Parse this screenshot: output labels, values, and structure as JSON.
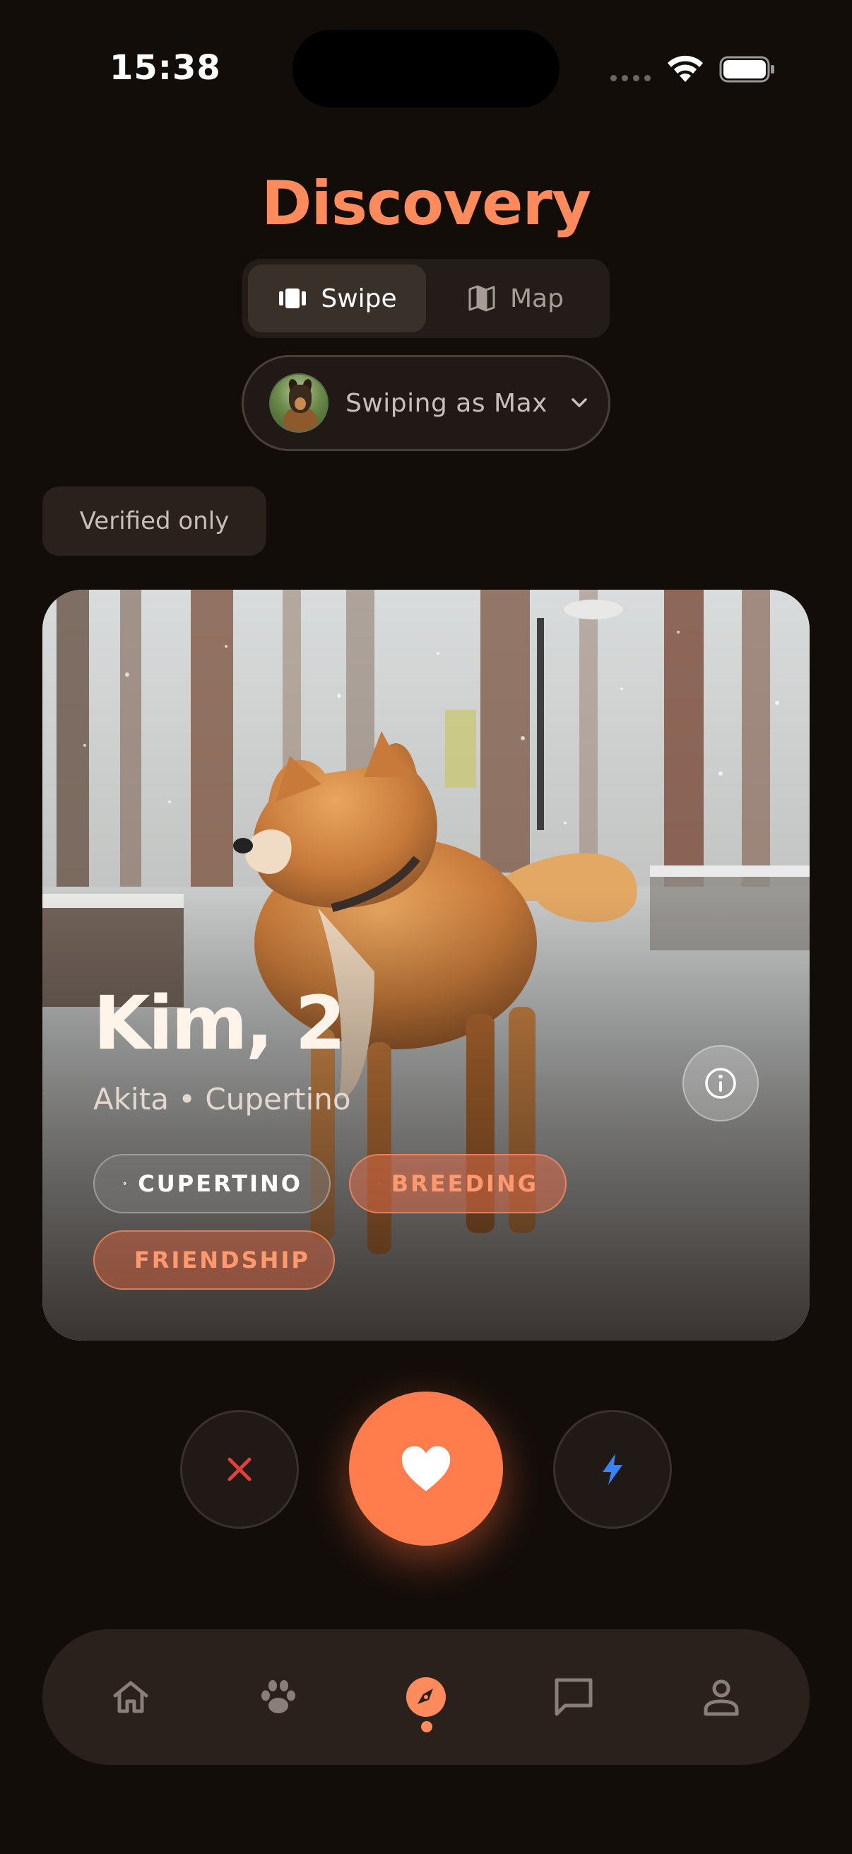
{
  "status": {
    "time": "15:38",
    "icons": [
      "cellular-signal-icon",
      "wifi-icon",
      "battery-icon"
    ]
  },
  "header": {
    "title": "Discovery"
  },
  "mode_toggle": {
    "options": [
      {
        "label": "Swipe",
        "icon": "cards-icon",
        "selected": true
      },
      {
        "label": "Map",
        "icon": "map-icon",
        "selected": false
      }
    ]
  },
  "profile_switcher": {
    "label": "Swiping as Max",
    "icon": "chevron-down-icon"
  },
  "filters": {
    "verified_label": "Verified only"
  },
  "card": {
    "name_age": "Kim, 2",
    "subtitle": "Akita • Cupertino",
    "chips": [
      {
        "label": "CUPERTINO",
        "icon": "location-pin-icon",
        "style": "neutral"
      },
      {
        "label": "BREEDING",
        "icon": "heart-icon",
        "style": "accent"
      },
      {
        "label": "FRIENDSHIP",
        "icon": "heart-icon",
        "style": "accent"
      }
    ]
  },
  "actions": {
    "pass": "close-icon",
    "like": "heart-icon",
    "boost": "lightning-icon"
  },
  "tabbar": {
    "items": [
      {
        "icon": "home-icon",
        "active": false
      },
      {
        "icon": "paw-icon",
        "active": false
      },
      {
        "icon": "compass-icon",
        "active": true
      },
      {
        "icon": "chat-icon",
        "active": false
      },
      {
        "icon": "person-icon",
        "active": false
      }
    ]
  },
  "colors": {
    "background": "#130d0a",
    "accent": "#ff8a5c",
    "like_button": "#ff7d4d",
    "pass_icon": "#e0403a",
    "boost_icon": "#3b82f6"
  }
}
